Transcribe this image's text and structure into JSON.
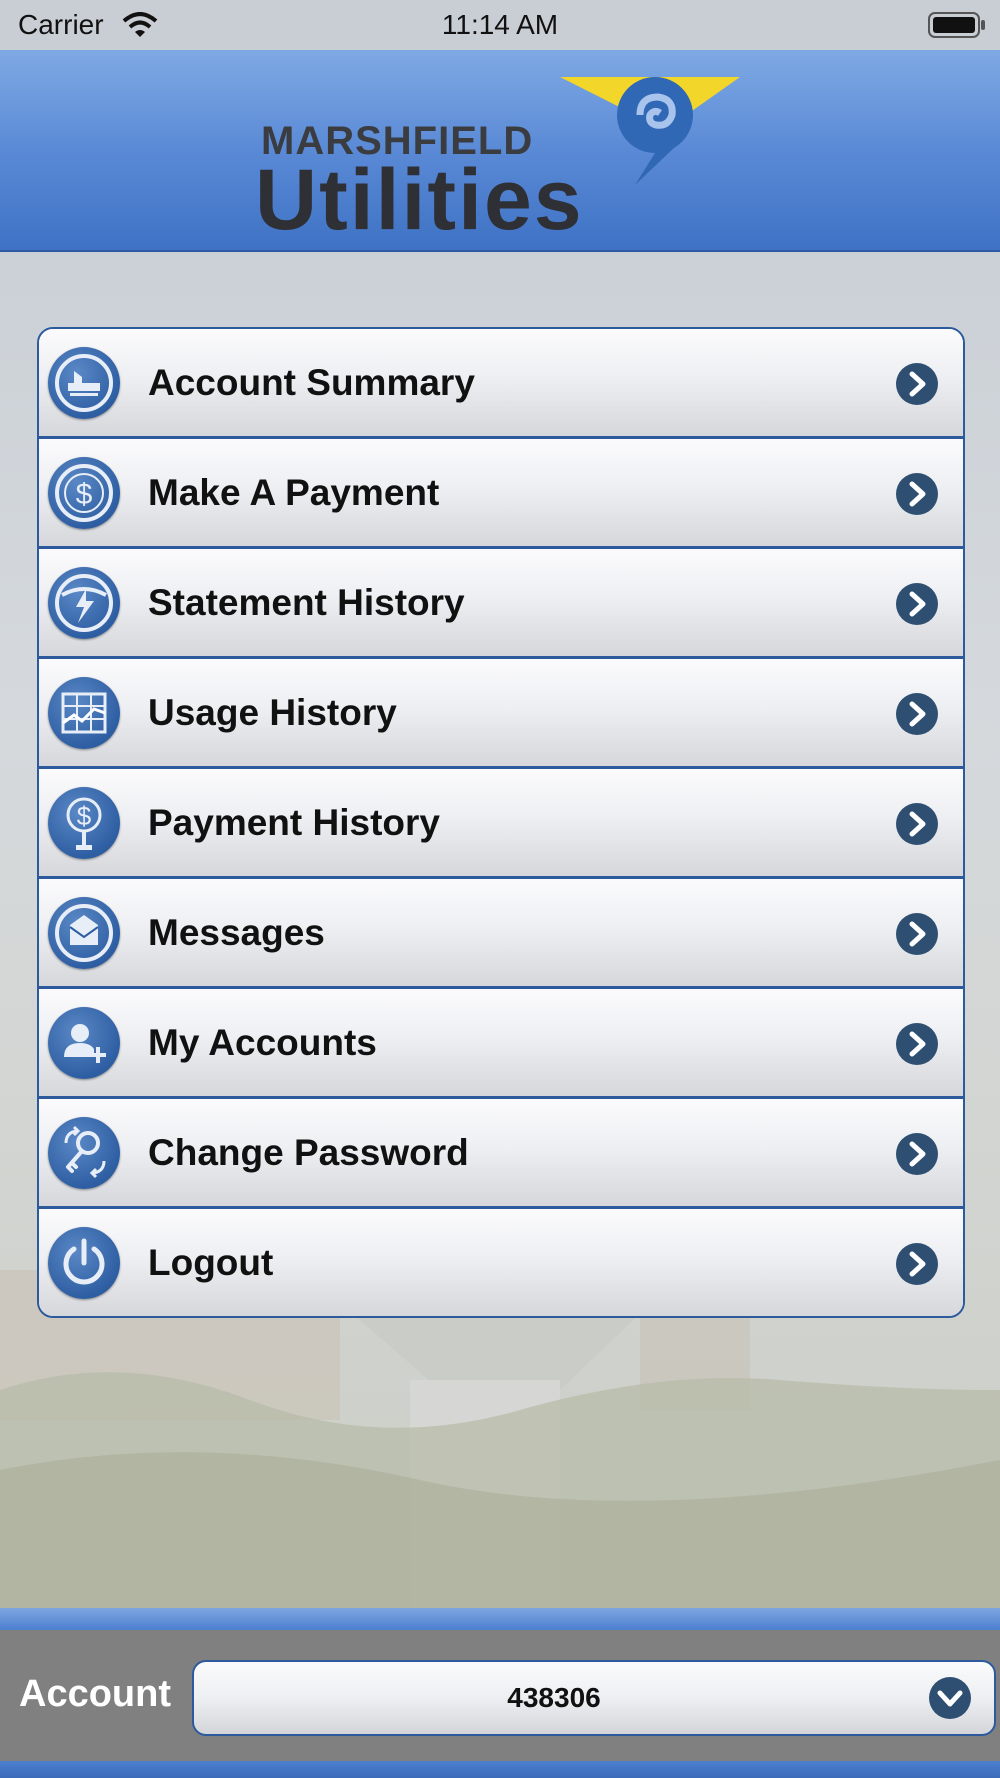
{
  "status_bar": {
    "carrier": "Carrier",
    "time": "11:14 AM"
  },
  "header": {
    "logo_line1": "MARSHFIELD",
    "logo_line2": "Utilities"
  },
  "menu": {
    "items": [
      {
        "label": "Account Summary",
        "icon": "account-summary-icon"
      },
      {
        "label": "Make A Payment",
        "icon": "dollar-icon"
      },
      {
        "label": "Statement History",
        "icon": "lightning-icon"
      },
      {
        "label": "Usage History",
        "icon": "chart-grid-icon"
      },
      {
        "label": "Payment History",
        "icon": "payment-dollar-icon"
      },
      {
        "label": "Messages",
        "icon": "envelope-icon"
      },
      {
        "label": "My Accounts",
        "icon": "add-user-icon"
      },
      {
        "label": "Change Password",
        "icon": "key-icon"
      },
      {
        "label": "Logout",
        "icon": "power-icon"
      }
    ]
  },
  "account_bar": {
    "label": "Account",
    "selected_account": "438306"
  },
  "colors": {
    "header_blue": "#5a8ad6",
    "menu_border": "#2d5a9c",
    "chevron": "#2f4f72",
    "account_bar_gray": "#808080"
  }
}
